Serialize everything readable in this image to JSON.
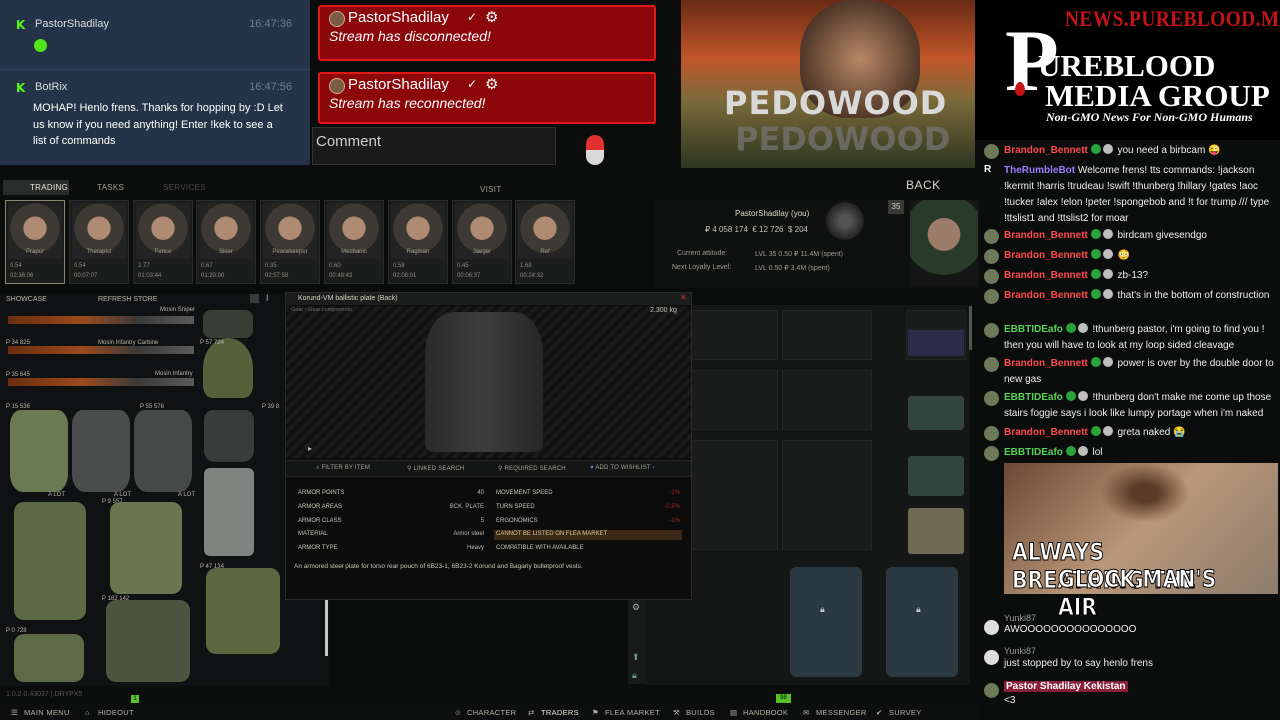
{
  "stream_chat": {
    "messages": [
      {
        "user": "PastorShadilay",
        "time": "16:47:36",
        "text": ""
      },
      {
        "user": "BotRix",
        "time": "16:47:56",
        "text": "MOHAP! Henlo frens. Thanks for hopping by :D Let us know if you need anything! Enter !kek to see a list of commands"
      }
    ]
  },
  "alerts": [
    {
      "user": "PastorShadilay",
      "status": "Stream has disconnected!"
    },
    {
      "user": "PastorShadilay",
      "status": "Stream has reconnected!"
    }
  ],
  "comment_placeholder": "Comment",
  "video_overlay_text": [
    "PEDOWOOD",
    "PEDOWOOD"
  ],
  "logo": {
    "site": "NEWS.PUREBLOOD.MEDIA",
    "line1": "UREBLOOD",
    "line2": "MEDIA GROUP",
    "cross_letter": "P",
    "tagline": "Non-GMO News For Non-GMO Humans"
  },
  "right_chat": [
    {
      "user": "Brandon_Bennett",
      "color": "#ff4a4a",
      "text": "you need a birbcam 😜"
    },
    {
      "user": "TheRumbleBot",
      "color": "#9a7cff",
      "text": "Welcome frens! tts commands: !jackson !kermit !harris !trudeau !swift !thunberg !hillary !gates !aoc !tucker !alex !elon !peter !spongebob and !t for trump /// type !ttslist1 and !ttslist2 for moar"
    },
    {
      "user": "Brandon_Bennett",
      "color": "#ff4a4a",
      "text": "birdcam givesendgo"
    },
    {
      "user": "Brandon_Bennett",
      "color": "#ff4a4a",
      "text": "😳"
    },
    {
      "user": "Brandon_Bennett",
      "color": "#ff4a4a",
      "text": "zb-13?"
    },
    {
      "user": "Brandon_Bennett",
      "color": "#ff4a4a",
      "text": "that's in the bottom of construction"
    },
    {
      "user": "EBBTIDEafo",
      "color": "#58d15a",
      "text": "!thunberg pastor, i'm going to find you ! then you will have to look at my loop sided cleavage"
    },
    {
      "user": "Brandon_Bennett",
      "color": "#ff4a4a",
      "text": "power is over by the double door to new gas"
    },
    {
      "user": "EBBTIDEafo",
      "color": "#58d15a",
      "text": "!thunberg don't make me come up those stairs foggie says i look like lumpy portage when i'm naked"
    },
    {
      "user": "Brandon_Bennett",
      "color": "#ff4a4a",
      "text": "greta naked 😭"
    },
    {
      "user": "EBBTIDEafo",
      "color": "#58d15a",
      "text": "lol"
    }
  ],
  "right_video_caption": [
    "ALWAYS BREATHING THE",
    "GLOCK MAN'S AIR"
  ],
  "right_chat_bottom": [
    {
      "user": "Yunki87",
      "text": "AWOOOOOOOOOOOOOOO"
    },
    {
      "user": "Yunki87",
      "text": "just stopped by to say henlo frens"
    },
    {
      "user": "Pastor Shadilay Kekistan",
      "text": "<3"
    }
  ],
  "game": {
    "tabs": {
      "trading": "TRADING",
      "tasks": "TASKS",
      "services": "SERVICES",
      "visit": "VISIT",
      "back": "BACK"
    },
    "traders": [
      {
        "name": "Prapor",
        "l1": "0.54",
        "l2": "02:36:06"
      },
      {
        "name": "Therapist",
        "l1": "0.54",
        "l2": "00:07:07"
      },
      {
        "name": "Fence",
        "l1": "2.77",
        "l2": "01:03:44"
      },
      {
        "name": "Skier",
        "l1": "0.67",
        "l2": "01:20:00"
      },
      {
        "name": "Peacekeeper",
        "l1": "0.35",
        "l2": "02:57:58"
      },
      {
        "name": "Mechanic",
        "l1": "0.60",
        "l2": "00:48:43"
      },
      {
        "name": "Ragman",
        "l1": "0.58",
        "l2": "02:08:01"
      },
      {
        "name": "Jaeger",
        "l1": "0.45",
        "l2": "00:06:37"
      },
      {
        "name": "Ref",
        "l1": "1.68",
        "l2": "00:24:32"
      }
    ],
    "player": {
      "name": "PastorShadilay (you)",
      "roubles": "₽ 4 058 174",
      "euros": "€ 12 726",
      "dollars": "$ 204",
      "level": "35",
      "attitude_label": "Current attitude:",
      "loyalty_label": "Next Loyalty Level:",
      "attitude_value": "LVL 35  0.50  ₽ 11.4M (spent)",
      "loyalty_value": "LVL   0.50  ₽ 3.4M (spent)"
    },
    "inventory_header": {
      "showcase": "SHOWCASE",
      "refresh": "REFRESH STORE"
    },
    "inventory_labels": [
      "Mosin Sniper",
      "Mosin Infantry Carbine",
      "Mosin Infantry",
      "P 34 825",
      "P 35 645",
      "P 57 724",
      "P 15 536",
      "P 55 576",
      "P 39 8",
      "P 9 557",
      "P 47 134",
      "P 182 142",
      "P 0 728",
      "A LOT",
      "A LOT",
      "A LOT"
    ],
    "item_window": {
      "title": "Korund-VM ballistic plate (Back)",
      "category": "Gear › Gear components",
      "weight": "2.300 kg",
      "actions": [
        "FILTER BY ITEM",
        "LINKED SEARCH",
        "REQUIRED SEARCH",
        "ADD TO WISHLIST"
      ],
      "stats_left": [
        {
          "label": "ARMOR POINTS",
          "value": "40"
        },
        {
          "label": "ARMOR AREAS",
          "value": "BCK. PLATE"
        },
        {
          "label": "ARMOR CLASS",
          "value": "5"
        },
        {
          "label": "MATERIAL",
          "value": "Armor steel"
        },
        {
          "label": "ARMOR TYPE",
          "value": "Heavy"
        }
      ],
      "stats_right": [
        {
          "label": "MOVEMENT SPEED",
          "value": "-1%"
        },
        {
          "label": "TURN SPEED",
          "value": "-0.5%"
        },
        {
          "label": "ERGONOMICS",
          "value": "-1%"
        },
        {
          "label": "CANNOT BE LISTED ON FLEA MARKET",
          "value": ""
        },
        {
          "label": "COMPATIBLE WITH AVAILABLE",
          "value": ""
        }
      ],
      "description": "An armored steel plate for torso rear pouch of 6B23-1, 6B23-2 Korund and Bagariy bulletproof vests."
    },
    "bottom_bar": [
      "MAIN MENU",
      "HIDEOUT",
      "CHARACTER",
      "TRADERS",
      "FLEA MARKET",
      "BUILDS",
      "HANDBOOK",
      "MESSENGER",
      "SURVEY"
    ],
    "version": "1.0.2.0.43037 | DRYPX5",
    "fps_badge": "98",
    "green_badge": "1"
  }
}
